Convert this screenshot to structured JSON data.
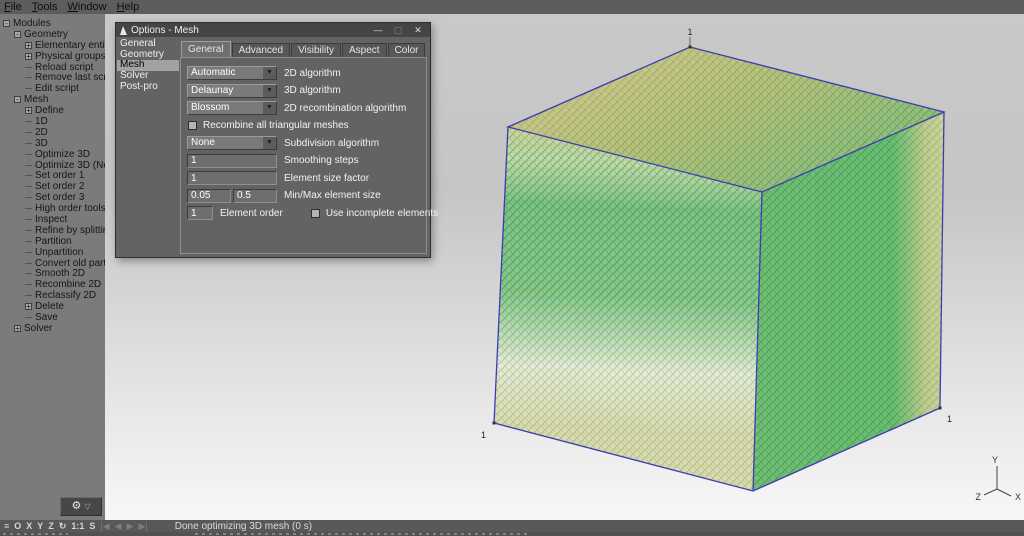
{
  "window": {
    "menu": [
      "File",
      "Tools",
      "Window",
      "Help"
    ]
  },
  "tree": {
    "items": [
      {
        "label": "Modules",
        "level": 0,
        "expander": "-"
      },
      {
        "label": "Geometry",
        "level": 1,
        "expander": "-"
      },
      {
        "label": "Elementary entit",
        "level": 2,
        "expander": "+"
      },
      {
        "label": "Physical groups",
        "level": 2,
        "expander": "+"
      },
      {
        "label": "Reload script",
        "level": 2
      },
      {
        "label": "Remove last scr",
        "level": 2
      },
      {
        "label": "Edit script",
        "level": 2
      },
      {
        "label": "Mesh",
        "level": 1,
        "expander": "-"
      },
      {
        "label": "Define",
        "level": 2,
        "expander": "+"
      },
      {
        "label": "1D",
        "level": 2
      },
      {
        "label": "2D",
        "level": 2
      },
      {
        "label": "3D",
        "level": 2
      },
      {
        "label": "Optimize 3D",
        "level": 2
      },
      {
        "label": "Optimize 3D (Ne",
        "level": 2
      },
      {
        "label": "Set order 1",
        "level": 2
      },
      {
        "label": "Set order 2",
        "level": 2
      },
      {
        "label": "Set order 3",
        "level": 2
      },
      {
        "label": "High order tools",
        "level": 2
      },
      {
        "label": "Inspect",
        "level": 2
      },
      {
        "label": "Refine by splittir",
        "level": 2
      },
      {
        "label": "Partition",
        "level": 2
      },
      {
        "label": "Unpartition",
        "level": 2
      },
      {
        "label": "Convert old part",
        "level": 2
      },
      {
        "label": "Smooth 2D",
        "level": 2
      },
      {
        "label": "Recombine 2D",
        "level": 2
      },
      {
        "label": "Reclassify 2D",
        "level": 2
      },
      {
        "label": "Delete",
        "level": 2,
        "expander": "+"
      },
      {
        "label": "Save",
        "level": 2
      },
      {
        "label": "Solver",
        "level": 1,
        "expander": "+"
      }
    ],
    "gear_icon": "⚙",
    "gear_caret": "▽"
  },
  "dialog": {
    "title": "Options - Mesh",
    "controls": {
      "minimize": "—",
      "maximize": "▢",
      "close": "✕"
    },
    "list": [
      "General",
      "Geometry",
      "Mesh",
      "Solver",
      "Post-pro"
    ],
    "selected_list_item": "Mesh",
    "tabs": [
      "General",
      "Advanced",
      "Visibility",
      "Aspect",
      "Color"
    ],
    "selected_tab": "General",
    "fields": {
      "algo2d": {
        "value": "Automatic",
        "label": "2D algorithm"
      },
      "algo3d": {
        "value": "Delaunay",
        "label": "3D algorithm"
      },
      "recomb": {
        "value": "Blossom",
        "label": "2D recombination algorithm"
      },
      "recombine_all": {
        "label": "Recombine all triangular meshes",
        "checked": false
      },
      "subdivision": {
        "value": "None",
        "label": "Subdivision algorithm"
      },
      "smoothing": {
        "value": "1",
        "label": "Smoothing steps"
      },
      "size_factor": {
        "value": "1",
        "label": "Element size factor"
      },
      "min_size": "0.05",
      "max_size": "0.5",
      "minmax_label": "Min/Max element size",
      "order": {
        "value": "1",
        "label": "Element order"
      },
      "incomplete": {
        "label": "Use incomplete elements",
        "checked": false
      }
    },
    "combo_arrow": "▼"
  },
  "viewport": {
    "vertex_labels": [
      "1",
      "1",
      "1"
    ],
    "axes": {
      "x": "X",
      "y": "Y",
      "z": "Z"
    }
  },
  "status_bar": {
    "items": [
      {
        "name": "model-browser-icon",
        "glyph": "≡"
      },
      {
        "name": "ortho-projection-button",
        "glyph": "O"
      },
      {
        "name": "x-view-button",
        "glyph": "X"
      },
      {
        "name": "y-view-button",
        "glyph": "Y"
      },
      {
        "name": "z-view-button",
        "glyph": "Z"
      },
      {
        "name": "rotate-view-button",
        "glyph": "↻"
      },
      {
        "name": "one-to-one-zoom-button",
        "glyph": "1:1"
      },
      {
        "name": "status-s-button",
        "glyph": "S"
      },
      {
        "name": "player-rewind-button",
        "glyph": "|◀",
        "dim": true
      },
      {
        "name": "player-back-button",
        "glyph": "◀",
        "dim": true
      },
      {
        "name": "player-forward-button",
        "glyph": "▶",
        "dim": true
      },
      {
        "name": "player-end-button",
        "glyph": "▶|",
        "dim": true
      }
    ],
    "message": "Done optimizing 3D mesh (0 s)"
  },
  "colors": {
    "edge_blue": "#3c3cb4",
    "mesh_green": "#2aa055",
    "mesh_yellow": "#c9c044",
    "mesh_tan": "#d6cfa2",
    "canvas_top": "#c9c9c9",
    "canvas_bottom": "#f7f7f7",
    "panel_gray": "#7b7b7b",
    "dialog_gray": "#636363",
    "statusbar_gray": "#58585a"
  }
}
